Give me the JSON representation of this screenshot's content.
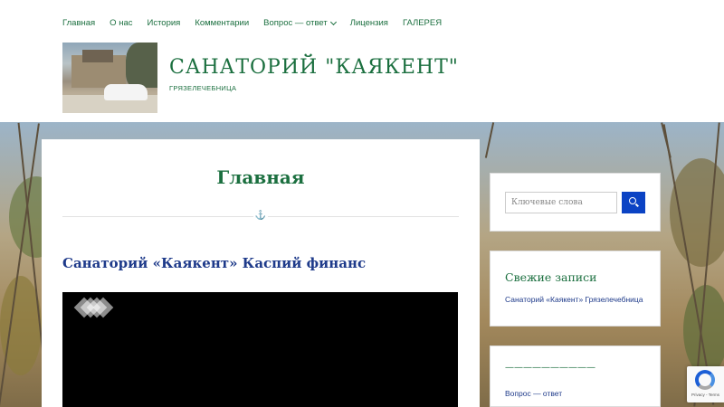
{
  "nav": {
    "items": [
      {
        "label": "Главная"
      },
      {
        "label": "О нас"
      },
      {
        "label": "История"
      },
      {
        "label": "Комментарии"
      },
      {
        "label": "Вопрос — ответ",
        "has_dropdown": true
      },
      {
        "label": "Лицензия"
      },
      {
        "label": "ГАЛЕРЕЯ"
      }
    ]
  },
  "header": {
    "site_title": "САНАТОРИЙ \"КАЯКЕНТ\"",
    "site_description": "ГРЯЗЕЛЕЧЕБНИЦА"
  },
  "main": {
    "page_title": "Главная",
    "divider_icon": "anchor-icon",
    "post_title": "Санаторий «Каякент» Каспий финанс"
  },
  "sidebar": {
    "search": {
      "placeholder": "Ключевые слова",
      "button_icon": "search-icon"
    },
    "recent": {
      "title": "Свежие записи",
      "items": [
        "Санаторий «Каякент» Грязелечебница"
      ]
    },
    "third": {
      "title": "——————————",
      "items": [
        "Вопрос — ответ"
      ]
    }
  },
  "recaptcha": {
    "terms": "Privacy - Terms"
  },
  "colors": {
    "accent_green": "#1b6f3f",
    "link_blue": "#1e3a8a",
    "button_blue": "#0b43c4"
  }
}
